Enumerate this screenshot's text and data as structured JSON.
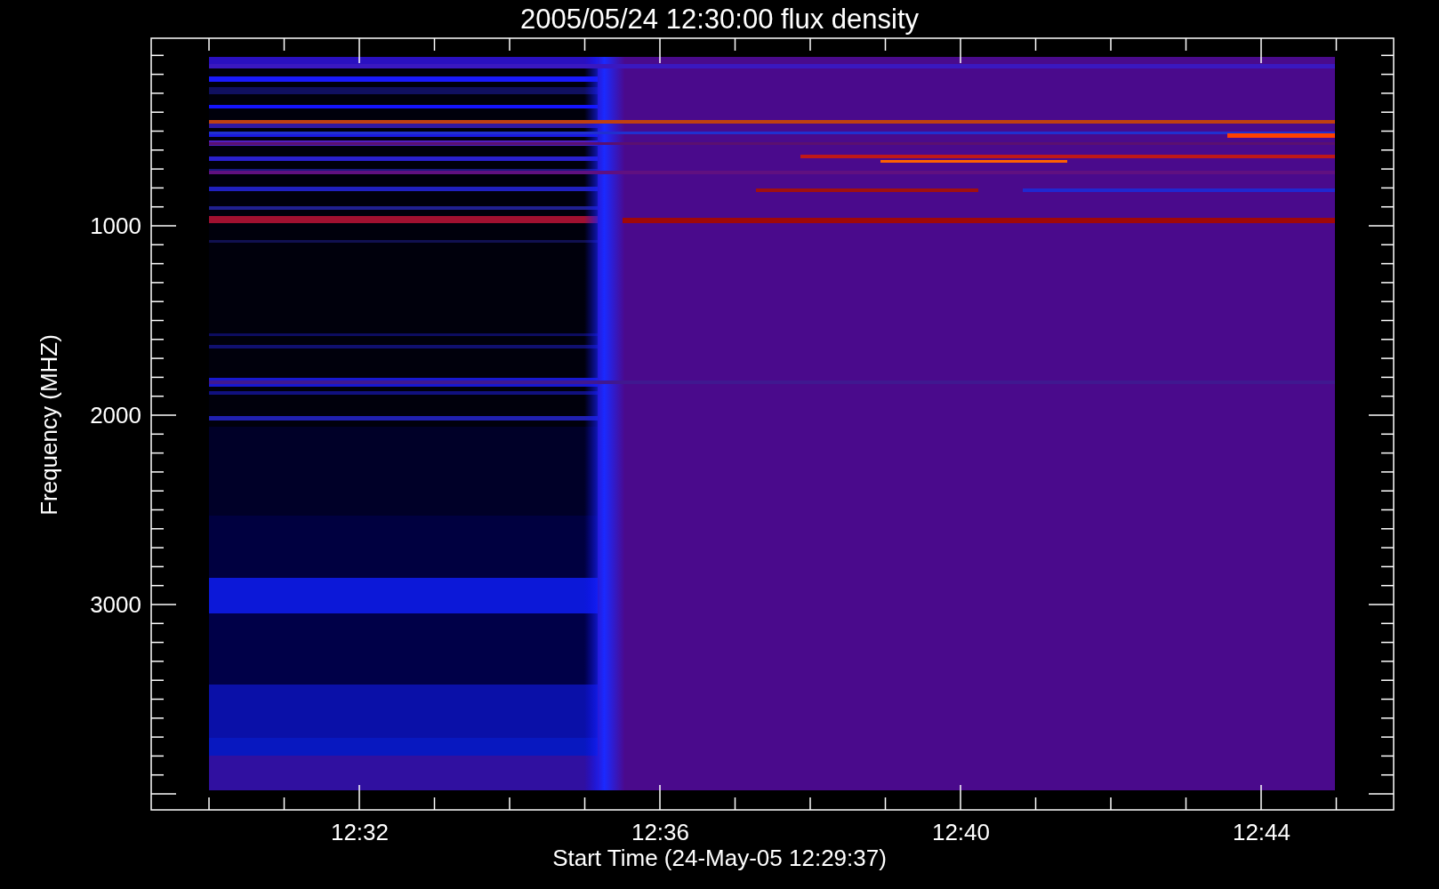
{
  "plot": {
    "title": "2005/05/24 12:30:00 flux density",
    "y_axis": {
      "label": "Frequency (MHZ)",
      "ticks": [
        "1000",
        "2000",
        "3000"
      ]
    },
    "x_axis": {
      "label": "Start Time (24-May-05 12:29:37)",
      "ticks": [
        "12:32",
        "12:36",
        "12:40",
        "12:44"
      ]
    }
  }
}
